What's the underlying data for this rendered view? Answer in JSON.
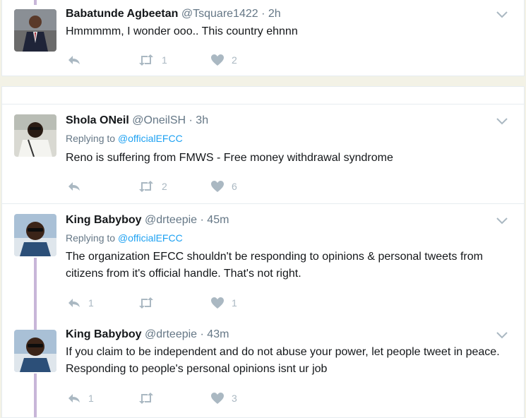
{
  "colors": {
    "accent": "#1da1f2",
    "muted": "#657786",
    "icon": "#aab8c2",
    "thread": "#c8b6d8"
  },
  "tweets": [
    {
      "name": "Babatunde Agbeetan",
      "handle": "@Tsquare1422",
      "time": "· 2h",
      "reply_prefix": "",
      "reply_to": "",
      "text": "Hmmmmm, I wonder ooo.. This country ehnnn",
      "reply_count": "",
      "retweet_count": "1",
      "like_count": "2"
    },
    {
      "name": "Shola ONeil",
      "handle": "@OneilSH",
      "time": "· 3h",
      "reply_prefix": "Replying to",
      "reply_to": "@officialEFCC",
      "text": "Reno is suffering from FMWS - Free money withdrawal syndrome",
      "reply_count": "",
      "retweet_count": "2",
      "like_count": "6"
    },
    {
      "name": "King Babyboy",
      "handle": "@drteepie",
      "time": "· 45m",
      "reply_prefix": "Replying to",
      "reply_to": "@officialEFCC",
      "text": "The organization EFCC shouldn't be responding to opinions & personal tweets from citizens from it's official handle. That's not right.",
      "reply_count": "1",
      "retweet_count": "",
      "like_count": "1"
    },
    {
      "name": "King Babyboy",
      "handle": "@drteepie",
      "time": "· 43m",
      "reply_prefix": "",
      "reply_to": "",
      "text": "If you claim to be independent and do not abuse your power, let people tweet in peace. Responding to people's personal opinions isnt ur job",
      "reply_count": "1",
      "retweet_count": "",
      "like_count": "3"
    }
  ]
}
